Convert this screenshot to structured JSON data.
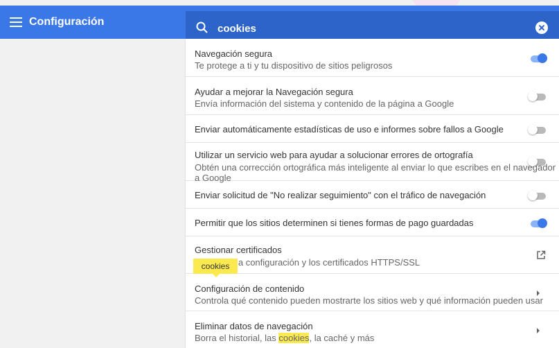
{
  "header": {
    "title": "Configuración",
    "search_value": "cookies"
  },
  "settings": [
    {
      "primary": "Navegación segura",
      "secondary": "Te protege a ti y tu dispositivo de sitios peligrosos",
      "control": "toggle",
      "enabled": true
    },
    {
      "primary": "Ayudar a mejorar la Navegación segura",
      "secondary": "Envía información del sistema y contenido de la página a Google",
      "control": "toggle",
      "enabled": false
    },
    {
      "primary": "Enviar automáticamente estadísticas de uso e informes sobre fallos a Google",
      "secondary": "",
      "control": "toggle",
      "enabled": false
    },
    {
      "primary": "Utilizar un servicio web para ayudar a solucionar errores de ortografía",
      "secondary": "Obtén una corrección ortográfica más inteligente al enviar lo que escribes en el navegador a Google",
      "control": "toggle",
      "enabled": false
    },
    {
      "primary": "Enviar solicitud de \"No realizar seguimiento\" con el tráfico de navegación",
      "secondary": "",
      "control": "toggle",
      "enabled": false
    },
    {
      "primary": "Permitir que los sitios determinen si tienes formas de pago guardadas",
      "secondary": "",
      "control": "toggle",
      "enabled": true
    },
    {
      "primary": "Gestionar certificados",
      "secondary": "Gestionar la configuración y los certificados HTTPS/SSL",
      "control": "external-link",
      "icon": "open-in-new-icon"
    },
    {
      "primary": "Configuración de contenido",
      "secondary": "Controla qué contenido pueden mostrarte los sitios web y qué información pueden usar",
      "control": "arrow",
      "icon": "chevron-right-icon"
    },
    {
      "primary": "Eliminar datos de navegación",
      "secondary_parts": [
        "Borra el historial, las ",
        "cookies",
        ", la caché y más"
      ],
      "control": "arrow",
      "icon": "chevron-right-icon"
    }
  ],
  "tooltip": {
    "text": "cookies"
  },
  "colors": {
    "accent": "#3b78e7",
    "search_bg": "#2d64c9",
    "highlight": "#fbe94f"
  }
}
